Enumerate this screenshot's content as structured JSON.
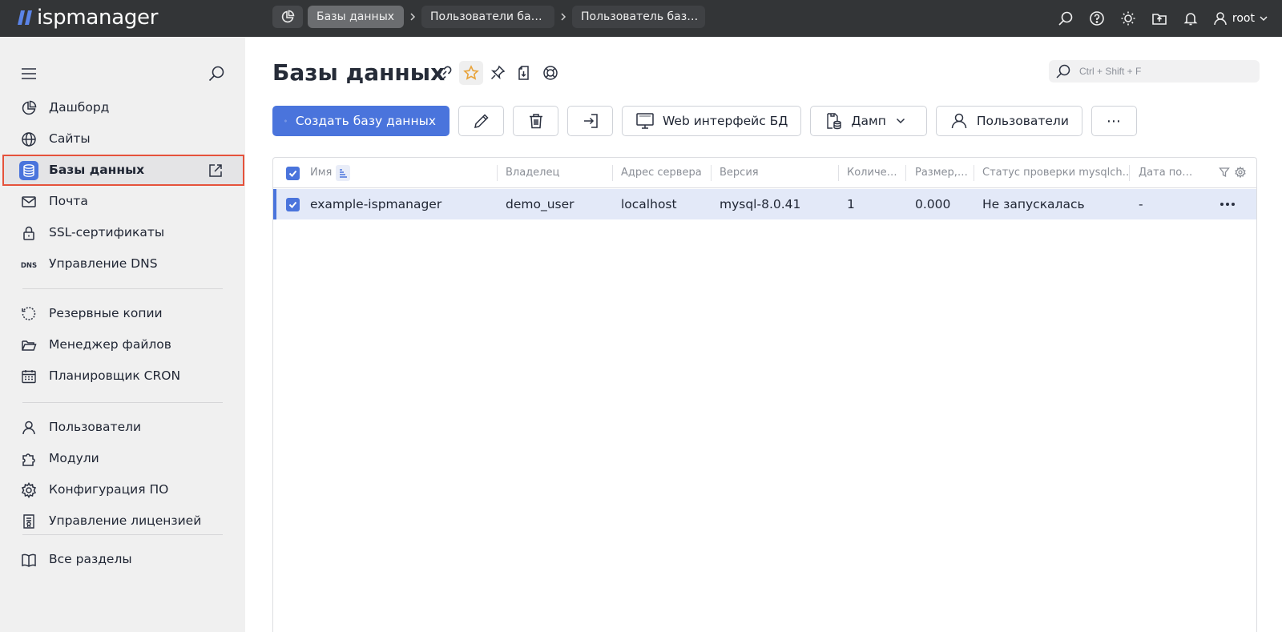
{
  "app": {
    "logo_text": "ispmanager"
  },
  "breadcrumbs": {
    "items": [
      {
        "label": "Базы данных",
        "active": true
      },
      {
        "label": "Пользователи ба…",
        "active": false
      },
      {
        "label": "Пользователь баз…",
        "active": false
      }
    ]
  },
  "topbar": {
    "user_name": "root",
    "icons": [
      "search-icon",
      "help-icon",
      "theme-sun-icon",
      "upload-icon",
      "bell-icon",
      "user-icon"
    ]
  },
  "sidebar": {
    "items": [
      {
        "label": "Дашборд",
        "icon": "dashboard-icon"
      },
      {
        "label": "Сайты",
        "icon": "globe-icon"
      },
      {
        "label": "Базы данных",
        "icon": "database-icon",
        "selected": true
      },
      {
        "label": "Почта",
        "icon": "mail-icon"
      },
      {
        "label": "SSL-сертификаты",
        "icon": "lock-icon"
      },
      {
        "label": "Управление DNS",
        "icon": "dns-icon",
        "icon_text": "DNS"
      },
      {
        "label": "Резервные копии",
        "icon": "backup-icon"
      },
      {
        "label": "Менеджер файлов",
        "icon": "folder-icon"
      },
      {
        "label": "Планировщик CRON",
        "icon": "calendar-icon"
      },
      {
        "label": "Пользователи",
        "icon": "user-icon"
      },
      {
        "label": "Модули",
        "icon": "puzzle-icon"
      },
      {
        "label": "Конфигурация ПО",
        "icon": "gear-icon"
      },
      {
        "label": "Управление лицензией",
        "icon": "license-icon"
      },
      {
        "label": "Все разделы",
        "icon": "book-icon"
      }
    ]
  },
  "page": {
    "title": "Базы данных",
    "search_placeholder": "Ctrl + Shift + F"
  },
  "toolbar": {
    "create_label": "Создать базу данных",
    "web_label": "Web интерфейс БД",
    "dump_label": "Дамп",
    "users_label": "Пользователи",
    "more_label": "⋯"
  },
  "table": {
    "columns": [
      "Имя",
      "Владелец",
      "Адрес сервера",
      "Версия",
      "Количе…",
      "Размер,…",
      "Статус проверки mysqlch…",
      "Дата по…"
    ],
    "rows": [
      {
        "name": "example-ispmanager",
        "owner": "demo_user",
        "server": "localhost",
        "version": "mysql-8.0.41",
        "count": "1",
        "size": "0.000",
        "check_status": "Не запускалась",
        "date": "-"
      }
    ]
  },
  "colors": {
    "accent": "#4a74dc",
    "topbar": "#333537",
    "sidebar": "#f0f0f0",
    "highlight_outline": "#e5523b",
    "row_selected": "#e3e9f8"
  }
}
